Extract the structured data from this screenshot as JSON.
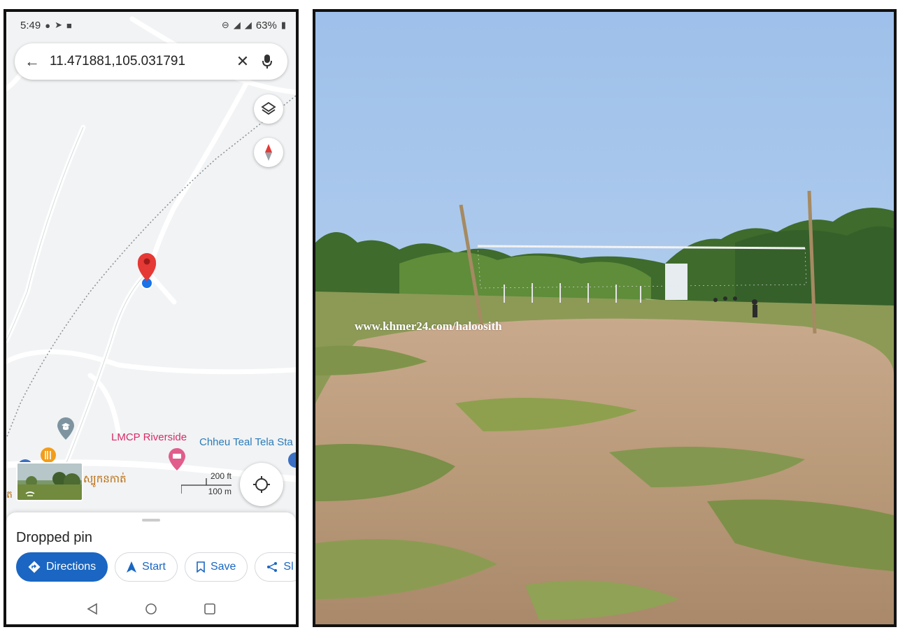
{
  "status_bar": {
    "time": "5:49",
    "battery": "63%"
  },
  "search": {
    "query": "11.471881,105.031791"
  },
  "map": {
    "pois": {
      "lmcp": "LMCP Riverside",
      "chheu": "Chheu Teal Tela Sta",
      "khmer_label": "ស្បូកនកាត់",
      "edge_label": "ត"
    },
    "scale": {
      "feet": "200 ft",
      "meters": "100 m"
    }
  },
  "sheet": {
    "title": "Dropped pin",
    "actions": {
      "directions": "Directions",
      "start": "Start",
      "save": "Save",
      "share_partial": "Sl"
    }
  },
  "photo": {
    "watermark": "www.khmer24.com/haloosith"
  },
  "colors": {
    "accent_blue": "#1a66c2",
    "pin_red": "#e53935",
    "poi_pink": "#d62d66",
    "poi_blue": "#2b7bb9",
    "poi_orange": "#b86a0c"
  }
}
